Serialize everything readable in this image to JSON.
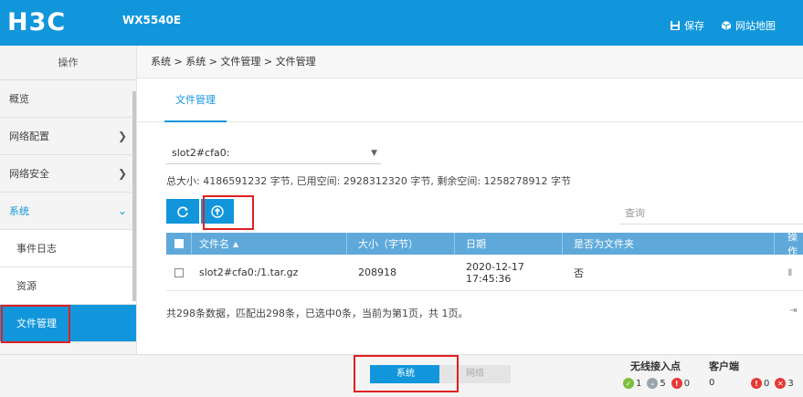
{
  "header": {
    "logo": "H3C",
    "model": "WX5540E",
    "save_label": "保存",
    "sitemap_label": "网站地图"
  },
  "sidebar": {
    "title": "操作",
    "items": [
      {
        "label": "概览"
      },
      {
        "label": "网络配置"
      },
      {
        "label": "网络安全"
      },
      {
        "label": "系统"
      }
    ],
    "subitems": [
      {
        "label": "事件日志"
      },
      {
        "label": "资源"
      },
      {
        "label": "文件管理"
      }
    ]
  },
  "breadcrumb": "系统 > 系统 > 文件管理 > 文件管理",
  "tab": {
    "label": "文件管理"
  },
  "storage": {
    "selected": "slot2#cfa0:",
    "summary": "总大小:  4186591232 字节,  已用空间:  2928312320 字节,  剩余空间:  1258278912 字节"
  },
  "search": {
    "placeholder": "查询"
  },
  "table": {
    "columns": [
      "文件名",
      "大小（字节）",
      "日期",
      "是否为文件夹",
      "操作"
    ],
    "rows": [
      {
        "name": "slot2#cfa0:/1.tar.gz",
        "size": "208918",
        "date": "2020-12-17 17:45:36",
        "is_dir": "否"
      }
    ]
  },
  "pager": "共298条数据，匹配出298条，已选中0条，当前为第1页，共 1页。",
  "footer": {
    "tab_system": "系统",
    "tab_network": "网络",
    "ap_title": "无线接入点",
    "ap_counts": [
      "1",
      "5",
      "0"
    ],
    "client_title": "客户端",
    "client_count": "0",
    "alarm_counts": [
      "0",
      "3"
    ]
  },
  "colors": {
    "brand": "#1296db",
    "table_header": "#5ea9da",
    "highlight": "#e02020"
  }
}
